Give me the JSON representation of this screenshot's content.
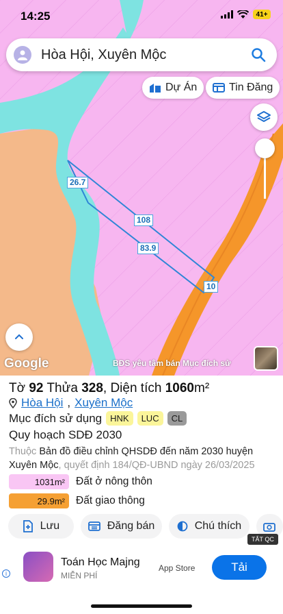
{
  "status": {
    "time": "14:25",
    "battery": "41+"
  },
  "search": {
    "text": "Hòa Hội, Xuyên Mộc"
  },
  "chips": {
    "project": "Dự Án",
    "listing": "Tin Đăng"
  },
  "map": {
    "labels": {
      "width": "26.7",
      "long_side": "108",
      "inner_side": "83.9",
      "short_side": "10"
    },
    "google": "Google",
    "watermark": "BĐS yêu tâm bán Mục đích sử"
  },
  "parcel": {
    "sheet_label": "Tờ",
    "sheet": "92",
    "lot_label": "Thửa",
    "lot": "328",
    "area_label": "Diện tích",
    "area": "1060",
    "area_unit": "m²",
    "commune": "Hòa Hội",
    "district": "Xuyên Mộc",
    "purpose_label": "Mục đích sử dụng",
    "tags": [
      "HNK",
      "LUC",
      "CL"
    ],
    "plan_label": "Quy hoạch SDĐ 2030",
    "source_prefix": "Thuộc",
    "source_main": "Bản đồ điều chỉnh QHSDĐ đến năm 2030 huyện Xuyên Mộc",
    "source_suffix": ", quyết định 184/QĐ-UBND ngày 26/03/2025"
  },
  "legend": [
    {
      "value": "1031m²",
      "label": "Đất ở nông thôn",
      "color": "#f9c6f4"
    },
    {
      "value": "29.9m²",
      "label": "Đất giao thông",
      "color": "#f5a033"
    }
  ],
  "actions": {
    "save": "Lưu",
    "post": "Đăng bán",
    "notes": "Chú thích"
  },
  "close_ad": "TẮT QC",
  "ad": {
    "title": "Toán Học Majng",
    "subtitle": "MIỄN PHÍ",
    "store": "App Store",
    "button": "Tải"
  },
  "colors": {
    "land": "#f7b6f0",
    "road": "#f5962a",
    "river": "#7ee3e1",
    "parcel": "#2f86d6",
    "brand": "#0a73e8"
  }
}
